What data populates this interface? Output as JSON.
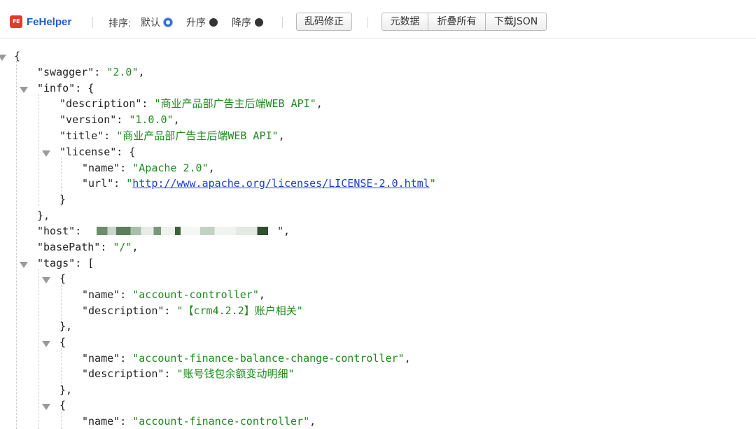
{
  "toolbar": {
    "app_name": "FeHelper",
    "logo_badge": "FE",
    "sort_label": "排序:",
    "sort_options": [
      {
        "label": "默认",
        "selected": true
      },
      {
        "label": "升序",
        "selected": false
      },
      {
        "label": "降序",
        "selected": false
      }
    ],
    "fix_encoding_button": "乱码修正",
    "buttons": [
      "元数据",
      "折叠所有",
      "下载JSON"
    ]
  },
  "json": {
    "open_brace": "{",
    "swagger": {
      "key": "\"swagger\"",
      "value": "\"2.0\""
    },
    "info": {
      "key": "\"info\"",
      "description": {
        "key": "\"description\"",
        "value": "\"商业产品部广告主后端WEB API\""
      },
      "version": {
        "key": "\"version\"",
        "value": "\"1.0.0\""
      },
      "title": {
        "key": "\"title\"",
        "value": "\"商业产品部广告主后端WEB API\""
      },
      "license": {
        "key": "\"license\"",
        "name": {
          "key": "\"name\"",
          "value": "\"Apache 2.0\""
        },
        "url": {
          "key": "\"url\"",
          "value": "http://www.apache.org/licenses/LICENSE-2.0.html"
        }
      }
    },
    "host": {
      "key": "\"host\""
    },
    "basePath": {
      "key": "\"basePath\"",
      "value": "\"/\""
    },
    "tags": {
      "key": "\"tags\"",
      "items": [
        {
          "name_key": "\"name\"",
          "name": "\"account-controller\"",
          "desc_key": "\"description\"",
          "description": "\"【crm4.2.2】账户相关\""
        },
        {
          "name_key": "\"name\"",
          "name": "\"account-finance-balance-change-controller\"",
          "desc_key": "\"description\"",
          "description": "\"账号钱包余额变动明细\""
        },
        {
          "name_key": "\"name\"",
          "name": "\"account-finance-controller\""
        }
      ]
    }
  },
  "colors": {
    "key": "#222222",
    "string": "#1e8a1e",
    "link": "#1a3fcc",
    "brand": "#1a5fc9"
  }
}
